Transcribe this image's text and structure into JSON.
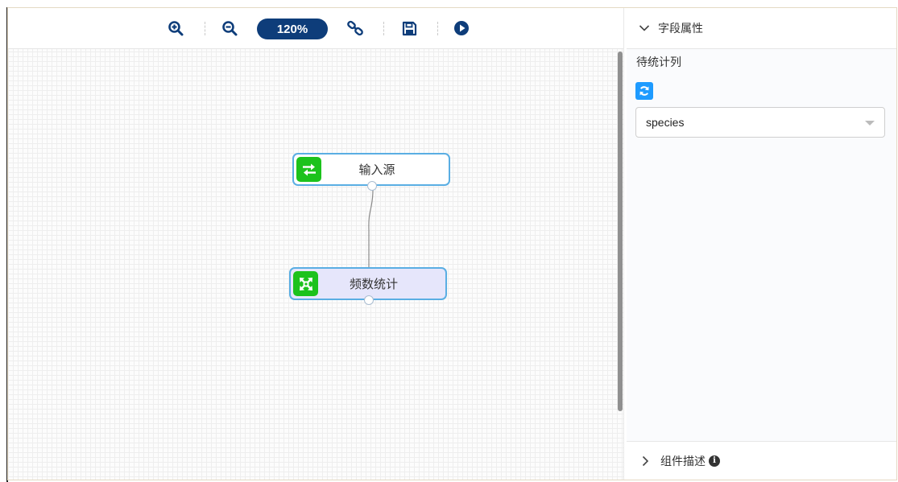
{
  "toolbar": {
    "zoom_level": "120%",
    "icons": [
      "zoom-in-icon",
      "zoom-out-icon",
      "link-icon",
      "save-icon",
      "play-icon"
    ]
  },
  "canvas": {
    "nodes": [
      {
        "id": "source",
        "label": "输入源",
        "icon": "swap-arrows-icon"
      },
      {
        "id": "freq",
        "label": "频数统计",
        "icon": "cross-arrows-icon"
      }
    ]
  },
  "panel": {
    "section_title": "字段属性",
    "field_label": "待统计列",
    "selected_column": "species",
    "footer_label": "组件描述"
  },
  "colors": {
    "accent": "#0e3d7a",
    "node_border": "#5aaee3",
    "node_icon_bg": "#1cc21c",
    "selected_node_bg": "#e6e6fb",
    "refresh_bg": "#1e9bff"
  }
}
